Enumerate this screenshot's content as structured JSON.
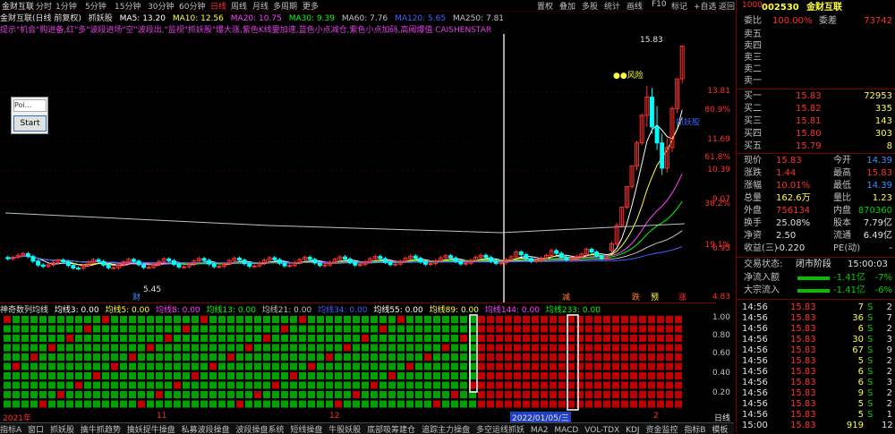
{
  "topbar": {
    "stock_name": "金财互联",
    "periods": [
      "分时",
      "1分钟",
      "5分钟",
      "15分钟",
      "30分钟",
      "60分钟",
      "日线",
      "周线",
      "月线",
      "多周期",
      "更多"
    ],
    "selected_period": "日线",
    "right_items": [
      "置权",
      "叠加",
      "多股",
      "统计",
      "画线",
      "F10",
      "标记",
      "+自选",
      "返回"
    ]
  },
  "legend": {
    "title": "金财互联(日线 前复权)",
    "indicator": "抓妖股",
    "mas": [
      {
        "label": "MA5: 13.20",
        "color": "#ffffff"
      },
      {
        "label": "MA10: 12.56",
        "color": "#ffff40"
      },
      {
        "label": "MA20: 10.75",
        "color": "#ff40ff"
      },
      {
        "label": "MA30: 9.39",
        "color": "#00ff00"
      },
      {
        "label": "MA60: 7.76",
        "color": "#c0c0c0"
      },
      {
        "label": "MA120: 5.65",
        "color": "#4060ff"
      },
      {
        "label": "MA250: 7.81",
        "color": "#c0c0c0"
      }
    ]
  },
  "tipline": "提示\"机会\"购进备,红\"多\"波段进场\"空\"波段出,\"监视\"抓妖股\"爆大涨,紫色K线要加速,蓝色小点减仓,紫色小点加码,高阈爆值 CAISHENSTAR",
  "chart_data": {
    "type": "candlestick",
    "title": "金财互联(日线 前复权)",
    "y_ticks": [
      4.83,
      6.95,
      9.07,
      10.39,
      11.69,
      13.81
    ],
    "pct_ticks": [
      "19.1%",
      "38.2%",
      "61.8%",
      "80.9%"
    ],
    "annotations": [
      "15.83",
      "●●风险",
      "抓妖股",
      "5.45",
      "2022/01/05/三"
    ],
    "markers": [
      "财",
      "减",
      "跌",
      "预",
      "涨"
    ],
    "x_ticks": [
      "2021年",
      "11",
      "12",
      "2022/01/05/三",
      "2"
    ],
    "ohlc_recent": [
      {
        "o": 6.9,
        "h": 7.3,
        "l": 6.8,
        "c": 7.2
      },
      {
        "o": 7.2,
        "h": 8.1,
        "l": 7.1,
        "c": 8.0
      },
      {
        "o": 8.0,
        "h": 8.8,
        "l": 7.9,
        "c": 8.8
      },
      {
        "o": 8.8,
        "h": 9.7,
        "l": 8.7,
        "c": 9.7
      },
      {
        "o": 9.7,
        "h": 10.6,
        "l": 9.6,
        "c": 10.6
      },
      {
        "o": 10.6,
        "h": 11.7,
        "l": 10.4,
        "c": 11.6
      },
      {
        "o": 11.6,
        "h": 12.9,
        "l": 11.5,
        "c": 12.8
      },
      {
        "o": 12.8,
        "h": 14.1,
        "l": 12.3,
        "c": 13.6
      },
      {
        "o": 13.6,
        "h": 14.0,
        "l": 12.0,
        "c": 12.3
      },
      {
        "o": 12.3,
        "h": 13.2,
        "l": 11.3,
        "c": 11.6
      },
      {
        "o": 11.6,
        "h": 12.0,
        "l": 10.2,
        "c": 10.5
      },
      {
        "o": 10.5,
        "h": 11.8,
        "l": 10.3,
        "c": 11.4
      },
      {
        "o": 11.4,
        "h": 13.2,
        "l": 11.2,
        "c": 13.1
      },
      {
        "o": 13.1,
        "h": 14.4,
        "l": 12.9,
        "c": 14.4
      },
      {
        "o": 14.4,
        "h": 15.83,
        "l": 14.2,
        "c": 15.83
      }
    ]
  },
  "indicator_panel": {
    "name": "神奇数列均线",
    "values": [
      {
        "label": "均线3: 0.00",
        "color": "#ffffff"
      },
      {
        "label": "均线5: 0.00",
        "color": "#ffff40"
      },
      {
        "label": "均线8: 0.00",
        "color": "#ff40ff"
      },
      {
        "label": "均线13: 0.00",
        "color": "#00ff00"
      },
      {
        "label": "均线21: 0.00",
        "color": "#c0c0c0"
      },
      {
        "label": "均线34: 0.00",
        "color": "#4060ff"
      },
      {
        "label": "均线55: 0.00",
        "color": "#ffffff"
      },
      {
        "label": "均线89: 0.00",
        "color": "#ffff40"
      },
      {
        "label": "均线144: 0.00",
        "color": "#ff40ff"
      },
      {
        "label": "均线233: 0.00",
        "color": "#00ff00"
      }
    ],
    "y_ticks": [
      "1.00",
      "0.80",
      "0.60",
      "0.40",
      "0.20"
    ]
  },
  "bottombar": {
    "x_labels": [
      "2021年",
      "11",
      "12",
      "2022/01/05/三",
      "2"
    ],
    "right_label": "日线"
  },
  "tabs": [
    "指标A",
    "窗口",
    "抓妖股",
    "擒牛抓趋势",
    "擒妖捉牛操盘",
    "私募波段操盘",
    "波段操盘系统",
    "短线操盘",
    "牛股妖股",
    "底部吸筹建仓",
    "追踪主力操盘",
    "多空运线抓妖",
    "MA2",
    "MACD",
    "VOL-TDX",
    "KDJ",
    "资金监控",
    "指标B",
    "模板"
  ],
  "widget": {
    "input_placeholder": "Poi...",
    "start_label": "Start"
  },
  "right_panel": {
    "code": "002530",
    "name": "金财互联",
    "ratio": {
      "label": "委比",
      "value": "100.00%",
      "diff_label": "委差",
      "diff": "73742"
    },
    "sells": [
      {
        "label": "卖五",
        "price": "",
        "vol": ""
      },
      {
        "label": "卖四",
        "price": "",
        "vol": ""
      },
      {
        "label": "卖三",
        "price": "",
        "vol": ""
      },
      {
        "label": "卖二",
        "price": "",
        "vol": ""
      },
      {
        "label": "卖一",
        "price": "",
        "vol": ""
      }
    ],
    "buys": [
      {
        "label": "买一",
        "price": "15.83",
        "vol": "72953"
      },
      {
        "label": "买二",
        "price": "15.82",
        "vol": "335"
      },
      {
        "label": "买三",
        "price": "15.81",
        "vol": "143"
      },
      {
        "label": "买四",
        "price": "15.80",
        "vol": "303"
      },
      {
        "label": "买五",
        "price": "15.79",
        "vol": "8"
      }
    ],
    "quotes": [
      {
        "l1": "现价",
        "v1": "15.83",
        "c1": "red",
        "l2": "今开",
        "v2": "14.39",
        "c2": "blue"
      },
      {
        "l1": "涨跌",
        "v1": "1.44",
        "c1": "red",
        "l2": "最高",
        "v2": "15.83",
        "c2": "red"
      },
      {
        "l1": "涨幅",
        "v1": "10.01%",
        "c1": "red",
        "l2": "最低",
        "v2": "14.39",
        "c2": "blue"
      },
      {
        "l1": "总量",
        "v1": "162.6万",
        "c1": "yel",
        "l2": "量比",
        "v2": "1.23",
        "c2": "yel"
      },
      {
        "l1": "外盘",
        "v1": "756134",
        "c1": "red",
        "l2": "内盘",
        "v2": "870360",
        "c2": "green"
      },
      {
        "l1": "换手",
        "v1": "25.08%",
        "c1": "wht",
        "l2": "股本",
        "v2": "7.79亿",
        "c2": "wht"
      },
      {
        "l1": "净资",
        "v1": "2.50",
        "c1": "wht",
        "l2": "流通",
        "v2": "6.49亿",
        "c2": "wht"
      },
      {
        "l1": "收益(三)",
        "v1": "-0.220",
        "c1": "wht",
        "l2": "PE(动)",
        "v2": "-",
        "c2": "wht"
      }
    ],
    "status": {
      "label": "交易状态:",
      "value": "闭市阶段",
      "time": "15:00:03"
    },
    "flows": [
      {
        "label": "净流入额",
        "value": "-1.41亿",
        "pct": "-7%"
      },
      {
        "label": "大宗流入",
        "value": "-1.41亿",
        "pct": "-6%"
      }
    ],
    "ticks": [
      {
        "t": "14:56",
        "p": "15.83",
        "v": "7",
        "f": "S",
        "n": "2"
      },
      {
        "t": "14:56",
        "p": "15.83",
        "v": "36",
        "f": "S",
        "n": "7"
      },
      {
        "t": "14:56",
        "p": "15.83",
        "v": "6",
        "f": "S",
        "n": "2"
      },
      {
        "t": "14:56",
        "p": "15.83",
        "v": "30",
        "f": "S",
        "n": "3"
      },
      {
        "t": "14:56",
        "p": "15.83",
        "v": "67",
        "f": "S",
        "n": "9"
      },
      {
        "t": "14:56",
        "p": "15.83",
        "v": "5",
        "f": "S",
        "n": "2"
      },
      {
        "t": "14:56",
        "p": "15.83",
        "v": "6",
        "f": "S",
        "n": "2"
      },
      {
        "t": "14:56",
        "p": "15.83",
        "v": "6",
        "f": "S",
        "n": "3"
      },
      {
        "t": "14:56",
        "p": "15.83",
        "v": "9",
        "f": "S",
        "n": "2"
      },
      {
        "t": "14:56",
        "p": "15.83",
        "v": "5",
        "f": "S",
        "n": "2"
      },
      {
        "t": "14:56",
        "p": "15.83",
        "v": "5",
        "f": "S",
        "n": "1"
      },
      {
        "t": "15:00",
        "p": "15.83",
        "v": "919",
        "f": "",
        "n": "12"
      }
    ],
    "tick_head": "1000"
  }
}
